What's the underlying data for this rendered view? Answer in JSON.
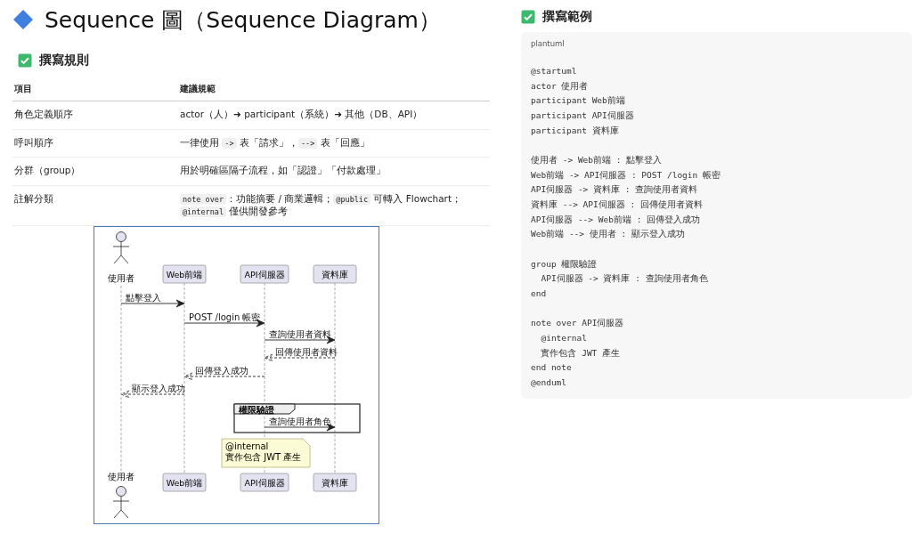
{
  "title": "Sequence 圖（Sequence Diagram）",
  "rules": {
    "heading": "撰寫規則",
    "columns": [
      "項目",
      "建議規範"
    ],
    "rows": [
      {
        "item": "角色定義順序",
        "spec": [
          {
            "kind": "text",
            "text": "actor（人）➜ participant（系統）➜ 其他（DB、API）"
          }
        ]
      },
      {
        "item": "呼叫順序",
        "spec": [
          {
            "kind": "text",
            "text": "一律使用 "
          },
          {
            "kind": "code",
            "text": "->"
          },
          {
            "kind": "text",
            "text": " 表「請求」，"
          },
          {
            "kind": "code",
            "text": "-->"
          },
          {
            "kind": "text",
            "text": " 表「回應」"
          }
        ]
      },
      {
        "item": "分群（group）",
        "spec": [
          {
            "kind": "text",
            "text": "用於明確區隔子流程，如「認證」「付款處理」"
          }
        ]
      },
      {
        "item": "註解分類",
        "spec": [
          {
            "kind": "code",
            "text": "note over"
          },
          {
            "kind": "text",
            "text": "：功能摘要 / 商業邏輯；"
          },
          {
            "kind": "code",
            "text": "@public"
          },
          {
            "kind": "text",
            "text": " 可轉入 Flowchart；"
          },
          {
            "kind": "code",
            "text": "@internal"
          },
          {
            "kind": "text",
            "text": " 僅供開發參考"
          }
        ]
      }
    ]
  },
  "diagram": {
    "participants": [
      {
        "kind": "actor",
        "top_name": "使用者",
        "bottom_name": "使用者"
      },
      {
        "kind": "box",
        "top_name": "Web前端",
        "bottom_name": "Web前端"
      },
      {
        "kind": "box",
        "top_name": "API伺服器",
        "bottom_name": "API伺服器"
      },
      {
        "kind": "box",
        "top_name": "資料庫",
        "bottom_name": "資料庫"
      }
    ],
    "messages": [
      {
        "kind": "request",
        "leftward": false,
        "text": "點擊登入"
      },
      {
        "kind": "request",
        "leftward": false,
        "text": "POST /login 帳密"
      },
      {
        "kind": "request",
        "leftward": false,
        "text": "查詢使用者資料"
      },
      {
        "kind": "reply",
        "leftward": true,
        "text": "回傳使用者資料"
      },
      {
        "kind": "reply",
        "leftward": true,
        "text": "回傳登入成功"
      },
      {
        "kind": "reply",
        "leftward": true,
        "text": "顯示登入成功"
      }
    ],
    "group": {
      "label": "權限驗證",
      "messages": [
        {
          "kind": "request",
          "leftward": false,
          "text": "查詢使用者角色"
        }
      ]
    },
    "note": {
      "lines": [
        "@internal",
        "實作包含 JWT 產生"
      ]
    }
  },
  "example": {
    "heading": "撰寫範例",
    "language": "plantuml",
    "blocks": [
      [
        "@startuml",
        "actor 使用者",
        "participant Web前端",
        "participant API伺服器",
        "participant 資料庫"
      ],
      [
        "使用者 -> Web前端 : 點擊登入",
        "Web前端 -> API伺服器 : POST /login 帳密",
        "API伺服器 -> 資料庫 : 查詢使用者資料",
        "資料庫 --> API伺服器 : 回傳使用者資料",
        "API伺服器 --> Web前端 : 回傳登入成功",
        "Web前端 --> 使用者 : 顯示登入成功"
      ],
      [
        "group 權限驗證",
        "  API伺服器 -> 資料庫 : 查詢使用者角色",
        "end"
      ],
      [
        "note over API伺服器",
        "  @internal",
        "  實作包含 JWT 產生",
        "end note",
        "@enduml"
      ]
    ]
  }
}
